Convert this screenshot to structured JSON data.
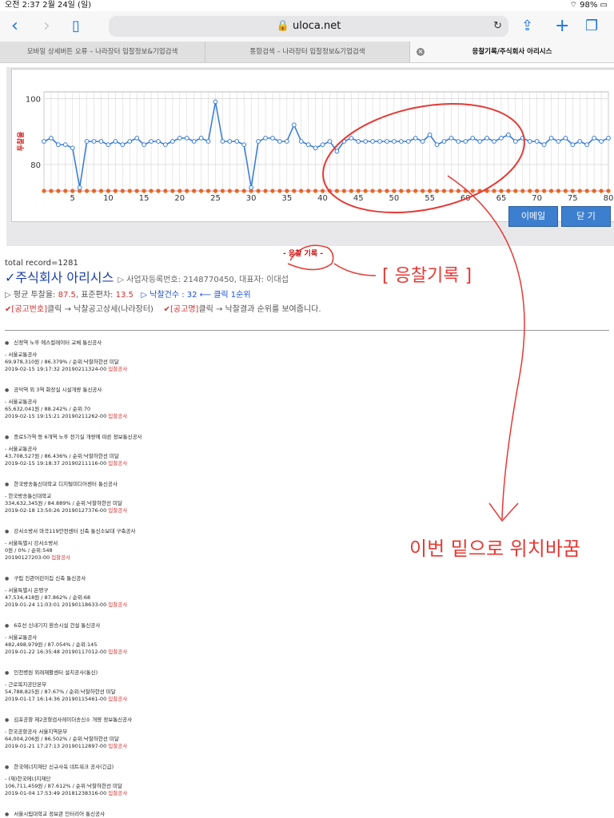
{
  "statusbar": {
    "time_date": "오전 2:37   2월 24일 (일)",
    "battery": "98%"
  },
  "browser": {
    "url": "uloca.net",
    "tabs": [
      "모바일 상세버튼 오류 – 나라장터 입찰정보&기업검색",
      "통합검색 – 나라장터 입찰정보&기업검색",
      "응찰기록/주식회사 아리시스"
    ]
  },
  "chart_data": {
    "type": "line",
    "ylabel": "투찰율",
    "yticks": [
      "100",
      "80"
    ],
    "xticks": [
      "5",
      "10",
      "15",
      "20",
      "25",
      "30",
      "35",
      "40",
      "45",
      "50",
      "55",
      "60",
      "65",
      "70",
      "75",
      "80"
    ],
    "ylim": [
      72,
      102
    ],
    "xlim": [
      0,
      80
    ],
    "series": [
      {
        "name": "",
        "color": "#3b7ed8",
        "values": [
          87,
          88,
          86,
          86,
          85,
          73,
          87,
          87,
          87,
          86,
          87,
          86,
          87,
          88,
          86,
          87,
          87,
          86,
          87,
          88,
          88,
          87,
          88,
          87,
          99,
          87,
          87,
          87,
          86,
          73,
          87,
          88,
          88,
          87,
          87,
          92,
          87,
          86,
          85,
          86,
          87,
          84,
          87,
          88,
          87,
          87,
          87,
          87,
          87,
          87,
          87,
          87,
          88,
          87,
          89,
          86,
          87,
          88,
          87,
          87,
          88,
          87,
          88,
          87,
          88,
          89,
          87,
          88,
          87,
          87,
          86,
          88,
          87,
          88,
          86,
          87,
          86,
          88,
          87,
          88
        ]
      },
      {
        "name": "",
        "color": "#e56a1f",
        "values": [
          72,
          72,
          72,
          72,
          72,
          72,
          72,
          72,
          72,
          72,
          72,
          72,
          72,
          72,
          72,
          72,
          72,
          72,
          72,
          72,
          72,
          72,
          72,
          72,
          72,
          72,
          72,
          72,
          72,
          72,
          72,
          72,
          72,
          72,
          72,
          72,
          72,
          72,
          72,
          72,
          72,
          72,
          72,
          72,
          72,
          72,
          72,
          72,
          72,
          72,
          72,
          72,
          72,
          72,
          72,
          72,
          72,
          72,
          72,
          72,
          72,
          72,
          72,
          72,
          72,
          72,
          72,
          72,
          72,
          72,
          72,
          72,
          72,
          72,
          72,
          72,
          72,
          72,
          72,
          72
        ]
      }
    ]
  },
  "buttons": {
    "email": "이메일",
    "close": "닫 기"
  },
  "record_tag": "- 응찰 기록 -",
  "total_record": "total record=1281",
  "company": {
    "name": "✓주식회사 아리시스",
    "info": "▷ 사업자등록번호: 2148770450, 대표자: 이대섭"
  },
  "stats": {
    "avg_prefix": "▷ 평균 투찰율: ",
    "avg": "87.5",
    "std_prefix": ", 표준편차: ",
    "std": "13.5",
    "win": "▷ 낙찰건수 : 32 ⟵ 클릭 1순위"
  },
  "help": {
    "a_tag": "✔[공고번호]",
    "a_text": "클릭 → 낙찰공고상세(나라장터)",
    "b_tag": "✔[공고명]",
    "b_text": "클릭 → 낙찰결과 순위를 보여줍니다."
  },
  "items": [
    {
      "title": "신정역 노후 에스컬레이터 교체 통신공사",
      "org": "- 서울교통공사",
      "amount": "69,978,310원 / 86.379% / 순위:낙찰하한선 미달",
      "date": "2019-02-15 19:17:32  20190211324-00",
      "category": "입찰공사"
    },
    {
      "title": "공덕역 외 3역 화장실 시설개량 통신공사",
      "org": "- 서울교통공사",
      "amount": "65,632,041원 / 88.242% / 순위:70",
      "date": "2019-02-15 19:15:21  20190211262-00",
      "category": "입찰공사"
    },
    {
      "title": "종로5가역 등 6개역 노후 전기실 개량에 따른 정보통신공사",
      "org": "- 서울교통공사",
      "amount": "43,708,527원 / 86.436% / 순위:낙찰하한선 미달",
      "date": "2019-02-15 19:18:37  20190211116-00",
      "category": "입찰공사"
    },
    {
      "title": "한국방송통신대학교 디지털미디어센터 통신공사",
      "org": "- 한국방송통신대학교",
      "amount": "334,632,345원 / 84.889% / 순위:낙찰하한선 미달",
      "date": "2019-02-18 13:50:26  20190127376-00",
      "category": "입찰공사"
    },
    {
      "title": "강서소방서 마곡119안전센터 신축 통신소보대 구축공사",
      "org": "- 서울특별시 강서소방서",
      "amount": "0원 / 0% / 순위:548",
      "date": "20190127203-00",
      "category": "입찰공사"
    },
    {
      "title": "구립 진관어린이집 신축 통신공사",
      "org": "- 서울특별시 은평구",
      "amount": "47,534,418원 / 87.862% / 순위:68",
      "date": "2019-01-24 11:03:01  20190118633-00",
      "category": "입찰공사"
    },
    {
      "title": "6호선 신내기지 환승시설 건설 통신공사",
      "org": "- 서울교통공사",
      "amount": "482,498,979원 / 87.054% / 순위:145",
      "date": "2019-01-22 16:35:48  20190117012-00",
      "category": "입찰공사"
    },
    {
      "title": "인천병원 외래재활센터 설치공사(통신)",
      "org": "- 근로복지공단본부",
      "amount": "54,788,825원 / 87.67% / 순위:낙찰하한선 미달",
      "date": "2019-01-17 16:14:36  20190115461-00",
      "category": "입찰공사"
    },
    {
      "title": "김포공항 제2공항검사레이더송신소 개량 정보통신공사",
      "org": "- 한국공항공사 서울지역본부",
      "amount": "64,004,206원 / 86.502% / 순위:낙찰하한선 미달",
      "date": "2019-01-21 17:27:13  20190112897-00",
      "category": "입찰공사"
    },
    {
      "title": "한국에너지재단 신규사옥 네트워크 공사(긴급)",
      "org": "- (재)한국에너지재단",
      "amount": "106,711,459원 / 87.612% / 순위:낙찰하한선 미달",
      "date": "2019-01-04 17:53:49  20181238316-00",
      "category": "입찰공사"
    },
    {
      "title": "서울시립대학교 정보관 인터리어 통신공사",
      "org": "",
      "amount": "",
      "date": "",
      "category": ""
    }
  ]
}
